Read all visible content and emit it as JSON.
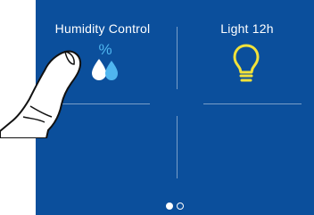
{
  "tiles": [
    {
      "label": "Humidity Control",
      "icon": "humidity-icon",
      "icon_symbol": "%"
    },
    {
      "label": "Light 12h",
      "icon": "light-bulb-icon"
    }
  ],
  "pagination": {
    "current_page": 1,
    "total_pages": 2
  },
  "colors": {
    "background": "#0b4f9c",
    "humidity_icon": "#4fb6f0",
    "bulb_icon": "#f2e23a",
    "text": "#ffffff"
  }
}
